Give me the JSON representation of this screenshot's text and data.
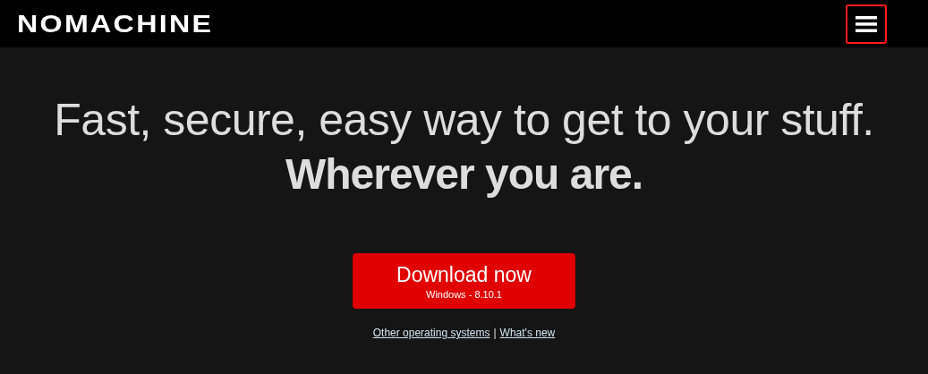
{
  "header": {
    "logo": "NOMACHINE",
    "menu_button": {
      "highlighted": true
    }
  },
  "hero": {
    "headline": "Fast, secure, easy way to get to your stuff.",
    "subheadline": "Wherever you are."
  },
  "download_button": {
    "label": "Download now",
    "sublabel": "Windows - 8.10.1"
  },
  "links": [
    {
      "text": "Other operating systems"
    },
    {
      "text": "What's new"
    }
  ],
  "link_separator": "|"
}
